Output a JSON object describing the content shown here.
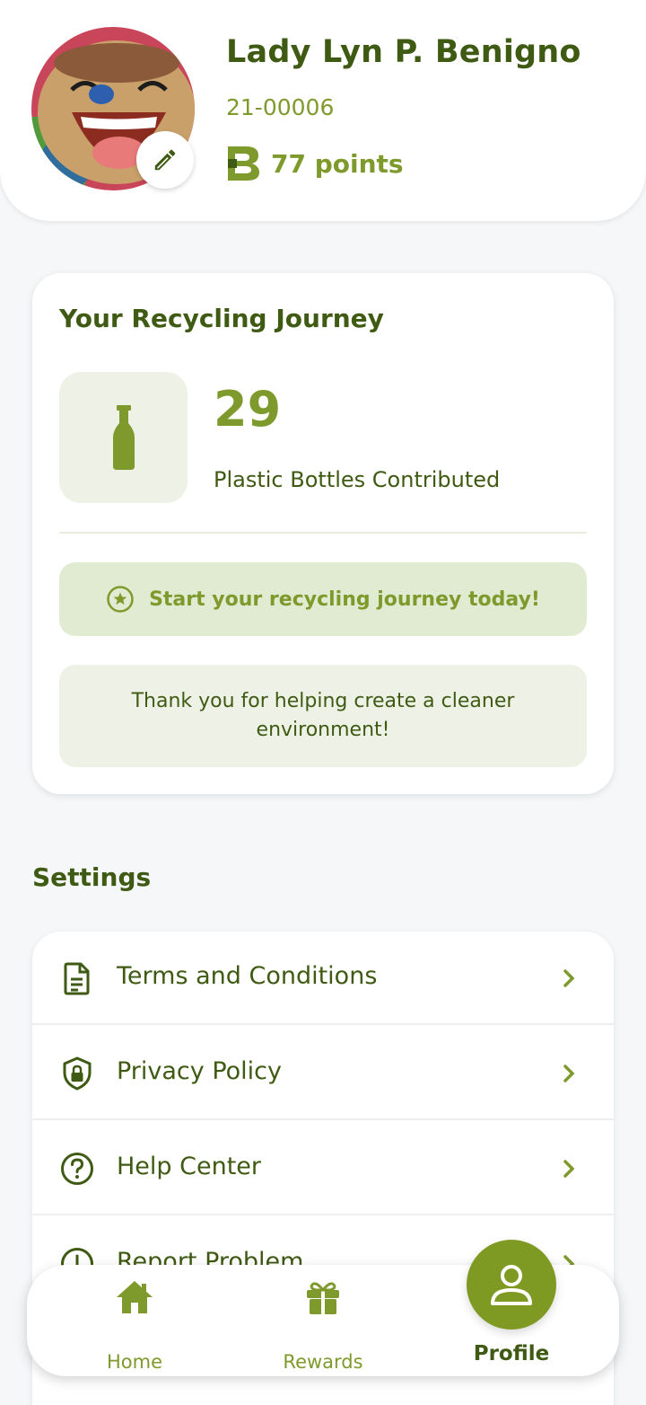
{
  "colors": {
    "primary_dark": "#3f5a12",
    "primary": "#7f9a2c",
    "accent_bg": "#eef2e6",
    "banner_bg": "#e1ebd2",
    "background": "#f5f7f9"
  },
  "header": {
    "name": "Lady Lyn P. Benigno",
    "id": "21-00006",
    "points_label": "77 points",
    "points_icon": "brand-b-logo-icon",
    "edit_icon": "pencil-icon"
  },
  "journey": {
    "title": "Your Recycling Journey",
    "bottle_count": "29",
    "bottle_label": "Plastic Bottles Contributed",
    "bottle_icon": "bottle-icon",
    "start_banner": "Start your recycling journey today!",
    "start_icon": "star-circle-icon",
    "thanks": "Thank you for helping create a cleaner environment!"
  },
  "settings": {
    "title": "Settings",
    "items": [
      {
        "label": "Terms and Conditions",
        "icon": "document-icon"
      },
      {
        "label": "Privacy Policy",
        "icon": "shield-lock-icon"
      },
      {
        "label": "Help Center",
        "icon": "help-circle-icon"
      },
      {
        "label": "Report Problem",
        "icon": "alert-circle-icon"
      }
    ]
  },
  "nav": {
    "items": [
      {
        "label": "Home",
        "icon": "home-icon"
      },
      {
        "label": "Rewards",
        "icon": "gift-icon"
      },
      {
        "label": "Profile",
        "icon": "person-icon",
        "active": true
      }
    ]
  }
}
